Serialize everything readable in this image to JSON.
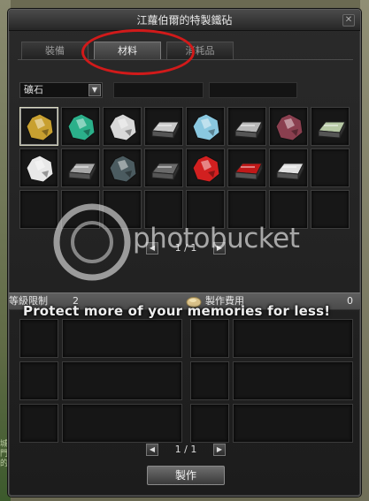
{
  "window": {
    "title": "江蘿伯爾的特製鐵砧"
  },
  "tabs": [
    {
      "label": "裝備",
      "active": false
    },
    {
      "label": "材料",
      "active": true
    },
    {
      "label": "消耗品",
      "active": false
    }
  ],
  "filter": {
    "category": "礦石"
  },
  "materials": [
    {
      "icon": "gold-ore-icon",
      "color": "#c8a030"
    },
    {
      "icon": "emerald-ore-icon",
      "color": "#2bb08a"
    },
    {
      "icon": "silver-ore-icon",
      "color": "#d8d8d8"
    },
    {
      "icon": "steel-ingot-icon",
      "color": "#c9c9c9"
    },
    {
      "icon": "aquamarine-ore-icon",
      "color": "#8ac8e0"
    },
    {
      "icon": "iron-ingot-icon",
      "color": "#b8b8b8"
    },
    {
      "icon": "opal-ore-icon",
      "color": "#8a3f4f"
    },
    {
      "icon": "mithril-ingot-icon",
      "color": "#b7c9a5"
    },
    {
      "icon": "diamond-ore-icon",
      "color": "#e8e8e8"
    },
    {
      "icon": "bronze-ingot-icon",
      "color": "#a6a6a6"
    },
    {
      "icon": "dark-crystal-icon",
      "color": "#4b5b60"
    },
    {
      "icon": "obsidian-ingot-icon",
      "color": "#6a6a6a"
    },
    {
      "icon": "ruby-ore-icon",
      "color": "#d22020"
    },
    {
      "icon": "ruby-ingot-icon",
      "color": "#c01818"
    },
    {
      "icon": "platinum-ingot-icon",
      "color": "#e0e0e0"
    }
  ],
  "pager_top": {
    "page": "1 / 1"
  },
  "info": {
    "level_label": "等級限制",
    "level_value": "2",
    "cost_label": "製作費用",
    "cost_value": "0"
  },
  "watermark": {
    "banner": "Protect more of your memories for less!",
    "logo_text": "photobucket"
  },
  "pager_bottom": {
    "page": "1 / 1"
  },
  "actions": {
    "make": "製作"
  },
  "background": {
    "left_text": "城門的"
  }
}
